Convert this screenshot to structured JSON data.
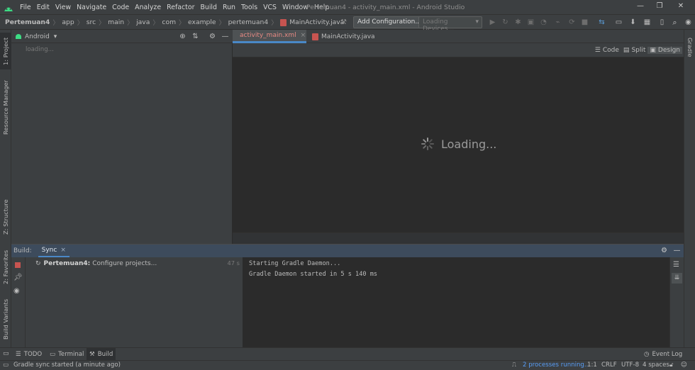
{
  "window": {
    "title": "Pertemuan4 - activity_main.xml - Android Studio",
    "menu": [
      "File",
      "Edit",
      "View",
      "Navigate",
      "Code",
      "Analyze",
      "Refactor",
      "Build",
      "Run",
      "Tools",
      "VCS",
      "Window",
      "Help"
    ],
    "controls": {
      "minimize": "—",
      "maximize": "❐",
      "close": "✕"
    }
  },
  "breadcrumb": [
    "Pertemuan4",
    "app",
    "src",
    "main",
    "java",
    "com",
    "example",
    "pertemuan4",
    "MainActivity.java"
  ],
  "toolbar": {
    "add_config_label": "Add Configuration...",
    "devices_placeholder": "Loading Devices...",
    "icons": [
      "hammer-icon",
      "run-icon",
      "rerun-icon",
      "debug-icon",
      "coverage-icon",
      "profile-icon",
      "attach-icon",
      "stop-icon",
      "sync-icon",
      "device-manager-icon",
      "sdk-manager-icon",
      "layout-inspector-icon",
      "search-icon"
    ]
  },
  "left_stripe": {
    "tabs": [
      "1: Project",
      "Resource Manager",
      "Z: Structure",
      "2: Favorites",
      "Build Variants"
    ]
  },
  "right_stripe": {
    "tabs": [
      "Gradle"
    ]
  },
  "project_panel": {
    "view_selector": "Android",
    "loading_text": "loading..."
  },
  "editor": {
    "tabs": [
      {
        "label": "activity_main.xml",
        "active": true,
        "closable": "×"
      },
      {
        "label": "MainActivity.java",
        "active": false,
        "closable": ""
      }
    ],
    "view_modes": [
      "Code",
      "Split",
      "Design"
    ],
    "active_view_mode": "Design",
    "loading_text": "Loading..."
  },
  "build_panel": {
    "label": "Build:",
    "tab": "Sync",
    "tab_close": "×",
    "tree_item": {
      "project": "Pertemuan4:",
      "text": "Configure projects...",
      "time": "47 s"
    },
    "console_lines": [
      "Starting Gradle Daemon...",
      "Gradle Daemon started in 5 s 140 ms"
    ]
  },
  "bottom_tabs": [
    "TODO",
    "Terminal",
    "Build"
  ],
  "active_bottom_tab": "Build",
  "event_log": "Event Log",
  "status": {
    "message": "Gradle sync started (a minute ago)",
    "processes": "2 processes running...",
    "position": "1:1",
    "line_sep": "CRLF",
    "encoding": "UTF-8",
    "indent": "4 spaces"
  },
  "colors": {
    "accent": "#589df6",
    "build_header": "#3d4b5c",
    "android_green": "#3ddc84"
  }
}
